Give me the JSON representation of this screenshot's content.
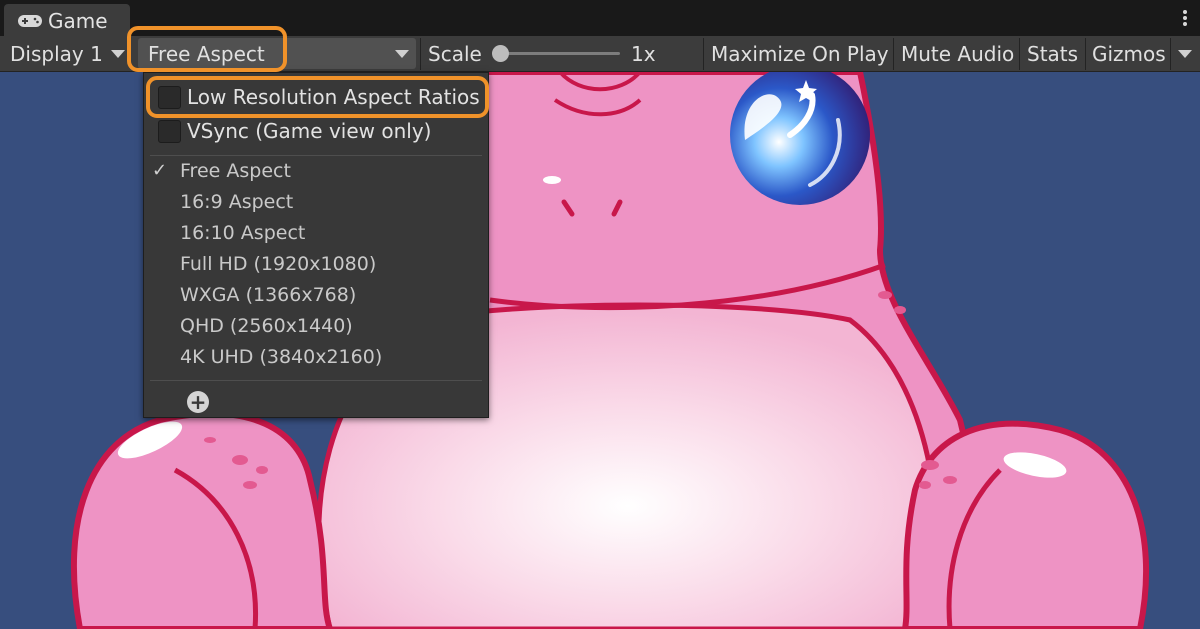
{
  "window": {
    "tab_title": "Game",
    "tab_icon": "gamepad-icon",
    "menu_icon": "kebab-menu-icon"
  },
  "toolbar": {
    "display": "Display 1",
    "aspect": "Free Aspect",
    "scale_label": "Scale",
    "scale_value": "1x",
    "scale_level": 0.0,
    "maximize": "Maximize On Play",
    "mute": "Mute Audio",
    "stats": "Stats",
    "gizmos": "Gizmos"
  },
  "menu": {
    "options": [
      {
        "label": "Low Resolution Aspect Ratios",
        "checked": false
      },
      {
        "label": "VSync (Game view only)",
        "checked": false
      }
    ],
    "aspects": [
      {
        "label": "Free Aspect",
        "selected": true
      },
      {
        "label": "16:9 Aspect",
        "selected": false
      },
      {
        "label": "16:10 Aspect",
        "selected": false
      },
      {
        "label": "Full HD (1920x1080)",
        "selected": false
      },
      {
        "label": "WXGA (1366x768)",
        "selected": false
      },
      {
        "label": "QHD (2560x1440)",
        "selected": false
      },
      {
        "label": "4K UHD (3840x2160)",
        "selected": false
      }
    ],
    "check_glyph": "✓",
    "add_icon": "plus-circle-icon"
  },
  "colors": {
    "highlight": "#f0922a",
    "scene_bg": "#374e7e",
    "frog_pink": "#ee93c4",
    "frog_outline": "#c8174a"
  }
}
